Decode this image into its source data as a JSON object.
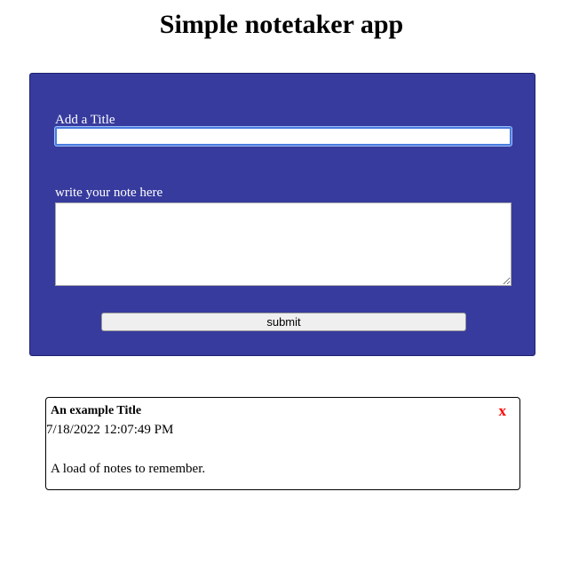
{
  "header": {
    "title": "Simple notetaker app"
  },
  "form": {
    "title_label": "Add a Title",
    "title_value": "",
    "note_label": "write your note here",
    "note_value": "",
    "submit_label": "submit",
    "background_color": "#373b9e"
  },
  "notes": [
    {
      "title": "An example Title",
      "timestamp": "7/18/2022 12:07:49 PM",
      "body": "A load of notes to remember.",
      "delete_label": "x",
      "delete_color": "#ff0000"
    }
  ]
}
